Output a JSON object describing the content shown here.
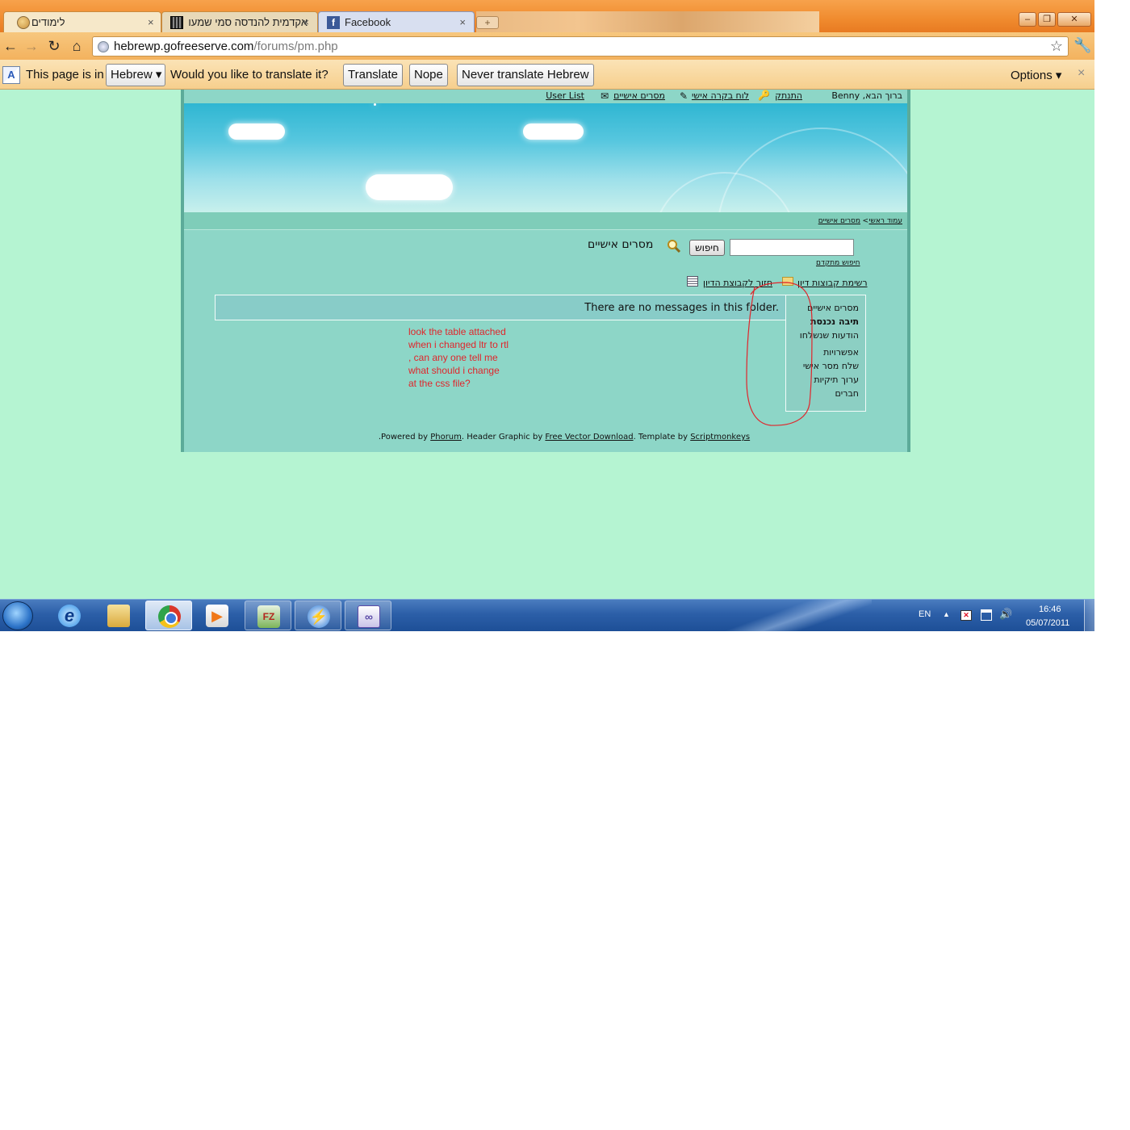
{
  "browser": {
    "tabs": [
      {
        "label": "לימודים",
        "close": "×"
      },
      {
        "label": "אקדמית להנדסה סמי שמעון",
        "close": "×"
      },
      {
        "label": "Facebook",
        "close": "×"
      }
    ],
    "window_controls": {
      "minimize": "–",
      "maximize": "❐",
      "close": "✕"
    },
    "url_host": "hebrewp.gofreeserve.com",
    "url_path": "/forums/pm.php",
    "nav": {
      "back": "←",
      "forward": "→",
      "reload": "↻",
      "home": "⌂"
    }
  },
  "translate_bar": {
    "prefix": "This page is in",
    "language": "Hebrew ▾",
    "question": "Would you like to translate it?",
    "translate_label": "Translate",
    "nope_label": "Nope",
    "never_label": "Never translate Hebrew",
    "options_label": "Options ▾",
    "close": "×"
  },
  "forum": {
    "welcome": "ברוך הבא, Benny",
    "logout": "התנתק",
    "control_panel": "לוח בקרה אישי",
    "private_messages": "מסרים אישיים",
    "user_list": "User List",
    "breadcrumb": {
      "home": "עמוד ראשי",
      "separator": ">",
      "current": "מסרים אישיים"
    },
    "search_button": "חיפוש",
    "page_title": "מסרים אישיים",
    "advanced_search": "חיפוש מתקדם",
    "forum_list_link": "רשימת קבוצות דיון",
    "back_to_forum_link": "חזור לקבוצת הדיון",
    "empty_message": "There are no messages in this folder.",
    "menu": [
      "מסרים אישיים",
      "תיבה נכנסת",
      "הודעות שנשלחו",
      "אפשרויות",
      "שלח מסר אישי",
      "ערוך תיקיות",
      "חברים"
    ],
    "footer": {
      "powered_by": "Powered by",
      "phorum": "Phorum",
      "header_graphic": ". Header Graphic by",
      "free_vector": "Free Vector Download",
      "template_by": ". Template by",
      "scriptmonkeys": "Scriptmonkeys",
      "trailing": "."
    }
  },
  "annotation": {
    "note": "look the table attached when i changed ltr to rtl , can any one tell me what should i change at the css file?",
    "color": "#e0252b"
  },
  "taskbar": {
    "language": "EN",
    "time": "16:46",
    "date": "05/07/2011"
  },
  "colors": {
    "page_background": "#b5f4d2",
    "forum_panel": "#8dd6c7",
    "chrome_theme": "#f08b2e",
    "taskbar": "#2c5fa8"
  }
}
